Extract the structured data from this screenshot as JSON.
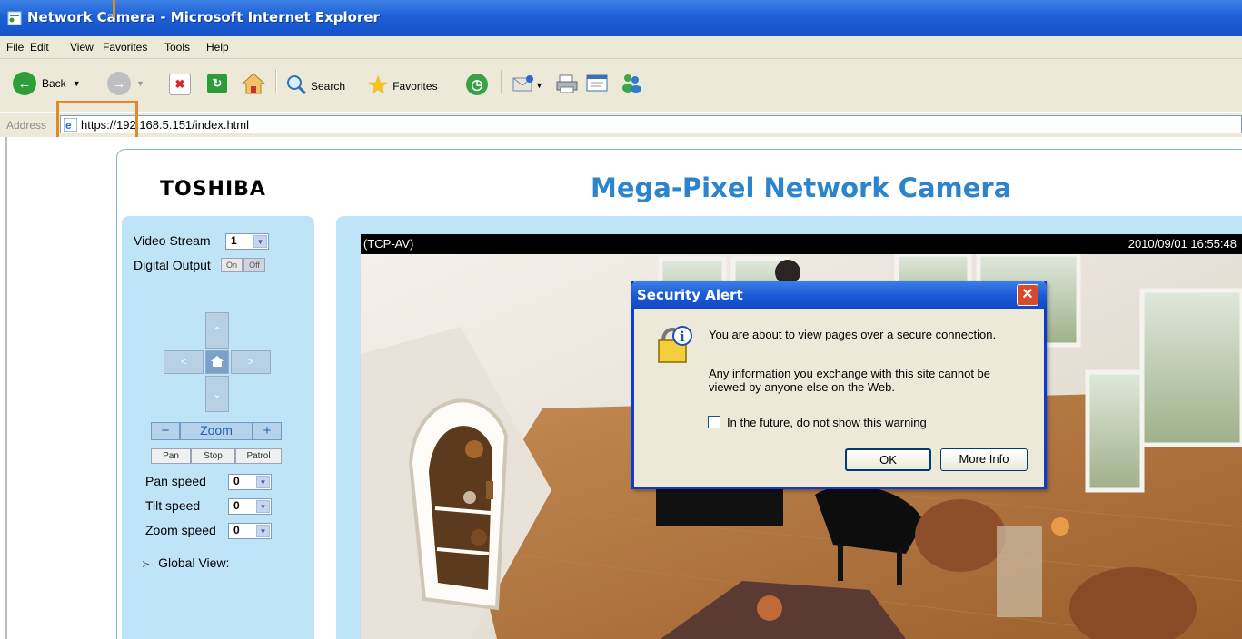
{
  "window": {
    "title": "Network Camera - Microsoft Internet Explorer"
  },
  "menu": [
    "File",
    "Edit",
    "View",
    "Favorites",
    "Tools",
    "Help"
  ],
  "toolbar": {
    "back": "Back",
    "search": "Search",
    "favorites": "Favorites"
  },
  "address": {
    "label": "Address",
    "url": "https://192.168.5.151/index.html"
  },
  "page": {
    "logo": "TOSHIBA",
    "title": "Mega-Pixel Network Camera"
  },
  "sidebar": {
    "video_stream_label": "Video Stream",
    "video_stream_value": "1",
    "digital_output_label": "Digital Output",
    "on_label": "On",
    "off_label": "Off",
    "zoom_minus": "−",
    "zoom_label": "Zoom",
    "zoom_plus": "+",
    "pan_label": "Pan",
    "stop_label": "Stop",
    "patrol_label": "Patrol",
    "pan_speed_label": "Pan speed",
    "pan_speed_value": "0",
    "tilt_speed_label": "Tilt speed",
    "tilt_speed_value": "0",
    "zoom_speed_label": "Zoom speed",
    "zoom_speed_value": "0",
    "global_view_label": "Global View:"
  },
  "video": {
    "stream_label": "(TCP-AV)",
    "timestamp": "2010/09/01 16:55:48"
  },
  "dialog": {
    "title": "Security Alert",
    "message1": "You are about to view pages over a secure connection.",
    "message2_line1": "Any information you exchange with this site cannot be",
    "message2_line2": "viewed by anyone else on the Web.",
    "checkbox_label": "In the future, do not show this warning",
    "ok_label": "OK",
    "more_info_label": "More Info"
  },
  "colors": {
    "accent": "#2c84cc",
    "panel": "#bfe3f7",
    "highlight": "#e08a2a",
    "xp_blue": "#1c5ad8"
  }
}
